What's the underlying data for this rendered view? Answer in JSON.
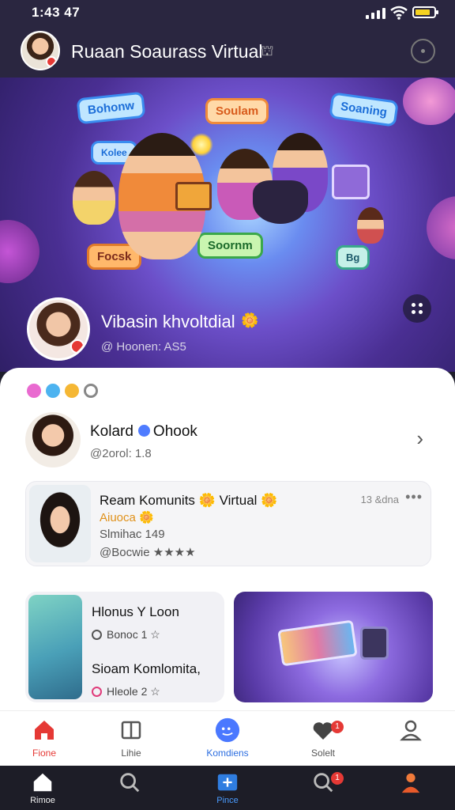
{
  "status_bar": {
    "time": "1:43 47"
  },
  "header": {
    "title": "Ruaan Soaurass Virtual",
    "title_badge": "⛫"
  },
  "hero": {
    "floats": [
      "Bohonw",
      "Soulam",
      "Soaning",
      "Kolee",
      "Focsk",
      "Soornm",
      "Bg"
    ],
    "profile_name": "Vibasin khvoltdial",
    "profile_badge": "⬤",
    "profile_handle": "@ Hoonen: AS5"
  },
  "person_row": {
    "name": "Kolard",
    "name_suffix": "Ohook",
    "handle": "@2orol: 1.8"
  },
  "post": {
    "title": "Ream Komunits",
    "title_mid": "Virtual",
    "line2": "Aiuoca",
    "line3": "Slmihac 149",
    "line4": "@Bocwie",
    "time": "13 &dna",
    "more": "•••"
  },
  "card_left": {
    "title1": "Hlonus Y Loon",
    "meta1": "Bonoc 1",
    "title2": "Sioam Komlomita,",
    "meta2": "Hleole 2"
  },
  "nav_top": [
    {
      "label": "Fione"
    },
    {
      "label": "Lihie"
    },
    {
      "label": "Komdiens"
    },
    {
      "label": "Solelt",
      "badge": "1"
    },
    {
      "label": ""
    }
  ],
  "nav_bottom": [
    {
      "label": "Rimoe"
    },
    {
      "label": ""
    },
    {
      "label": "Pince"
    },
    {
      "label": "",
      "badge": "1"
    },
    {
      "label": ""
    }
  ],
  "colors": {
    "accent": "#e53935",
    "brand_blue": "#4a78ff",
    "header_bg": "#2a2640",
    "nav_dark": "#1d1d27"
  }
}
